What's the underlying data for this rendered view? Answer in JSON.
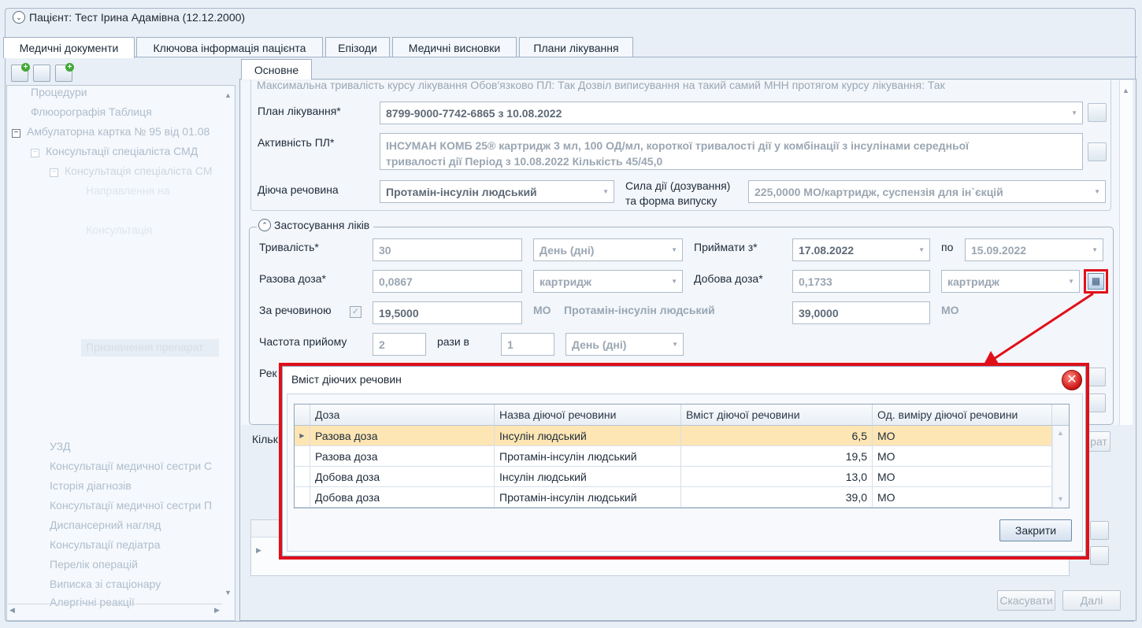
{
  "patient": {
    "title": "Пацієнт: Тест Ірина Адамівна (12.12.2000)"
  },
  "main_tabs": [
    "Медичні документи",
    "Ключова інформація пацієнта",
    "Епізоди",
    "Медичні висновки",
    "Плани лікування"
  ],
  "sidebar": {
    "items": [
      "Процедури",
      "Флюорографія Таблиця",
      "Амбулаторна картка № 95 від 01.08",
      "Консультації спеціаліста СМД",
      "Консультація спеціаліста СМ",
      "Направлення на",
      "Консультація",
      "Призначення препарат",
      "УЗД",
      "Консультації медичної сестри С",
      "Історія діагнозів",
      "Консультації медичної сестри П",
      "Диспансерний нагляд",
      "Консультації педіатра",
      "Перелік операцій",
      "Виписка зі стаціонару",
      "Алергічні реакції"
    ]
  },
  "sub_tab": "Основне",
  "form": {
    "top_line": "Максимальна тривалість курсу лікування    Обов'язково ПЛ: Так   Дозвіл виписування на такий самий МНН протягом курсу лікування: Так",
    "plan_label": "План лікування*",
    "plan_value": "8799-9000-7742-6865 з 10.08.2022",
    "activity_label": "Активність ПЛ*",
    "activity_line1": "ІНСУМАН КОМБ 25® картридж 3 мл, 100 ОД/мл, короткої тривалості дії у комбінації з інсулінами середньої",
    "activity_line2": "тривалості дії Період з 10.08.2022 Кількість 45/45,0",
    "substance_label": "Діюча речовина",
    "substance_value": "Протамін-інсулін людський",
    "strength_label_1": "Сила дії (дозування)",
    "strength_label_2": "та форма випуску",
    "strength_value": "225,0000 МО/картридж, суспензія для ін`єкцій"
  },
  "apply": {
    "legend": "Застосування ліків",
    "duration_label": "Тривалість*",
    "duration_value": "30",
    "duration_unit": "День (дні)",
    "take_from_label": "Приймати з*",
    "take_from_value": "17.08.2022",
    "to_label": "по",
    "to_value": "15.09.2022",
    "single_dose_label": "Разова доза*",
    "single_dose_value": "0,0867",
    "single_dose_unit": "картридж",
    "daily_dose_label": "Добова доза*",
    "daily_dose_value": "0,1733",
    "daily_dose_unit": "картридж",
    "by_substance_label": "За речовиною",
    "by_substance_value": "19,5000",
    "unit_mo": "МО",
    "substance_name": "Протамін-інсулін людський",
    "by_substance_daily": "39,0000",
    "freq_label": "Частота прийому",
    "freq_value": "2",
    "times_in_label": "рази в",
    "period_value": "1",
    "period_unit": "День (дні)",
    "rec_label_partial": "Рек",
    "qty_label_partial": "Кільк",
    "rat_partial": "рат"
  },
  "footer": {
    "cancel": "Скасувати",
    "next": "Далі"
  },
  "dialog": {
    "title": "Вміст діючих речовин",
    "columns": [
      "Доза",
      "Назва діючої речовини",
      "Вміст діючої речовини",
      "Од. виміру діючої речовини"
    ],
    "rows": [
      {
        "dose": "Разова доза",
        "name": "Інсулін людський",
        "amount": "6,5",
        "unit": "МО"
      },
      {
        "dose": "Разова доза",
        "name": "Протамін-інсулін людський",
        "amount": "19,5",
        "unit": "МО"
      },
      {
        "dose": "Добова доза",
        "name": "Інсулін людський",
        "amount": "13,0",
        "unit": "МО"
      },
      {
        "dose": "Добова доза",
        "name": "Протамін-інсулін людський",
        "amount": "39,0",
        "unit": "МО"
      }
    ],
    "close_button": "Закрити"
  },
  "colors": {
    "highlight": "#e0101a",
    "selected_row": "#fde6b4",
    "background": "#e9eff6"
  }
}
